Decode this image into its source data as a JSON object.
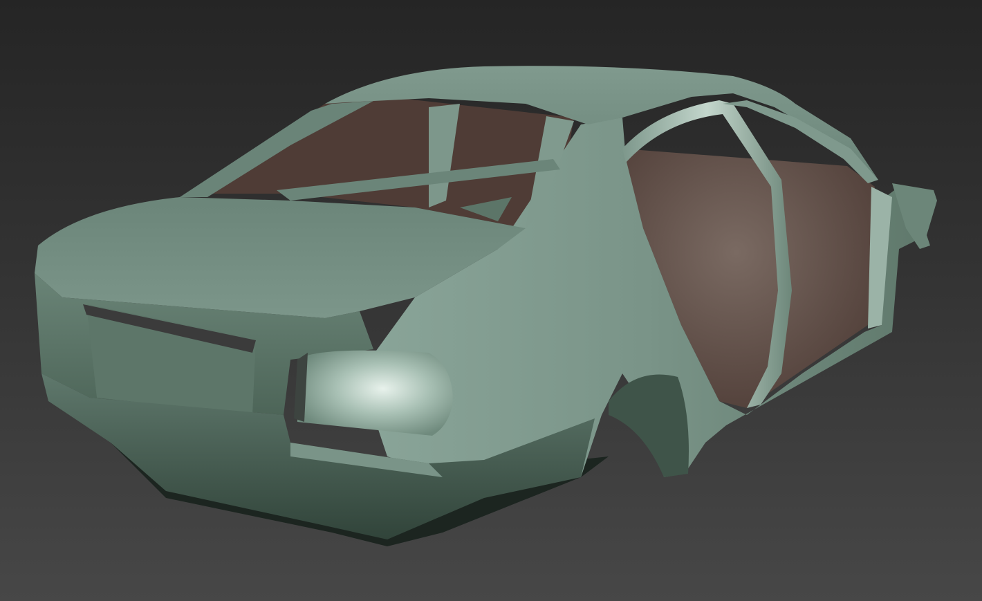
{
  "viewport": {
    "background_top": "#252525",
    "background_bottom": "#474747",
    "model": {
      "name": "sedan-body-shell",
      "paint_color": "#6e8a7c",
      "interior_color": "#5a4640",
      "shadow_color": "#1f2a24"
    }
  }
}
